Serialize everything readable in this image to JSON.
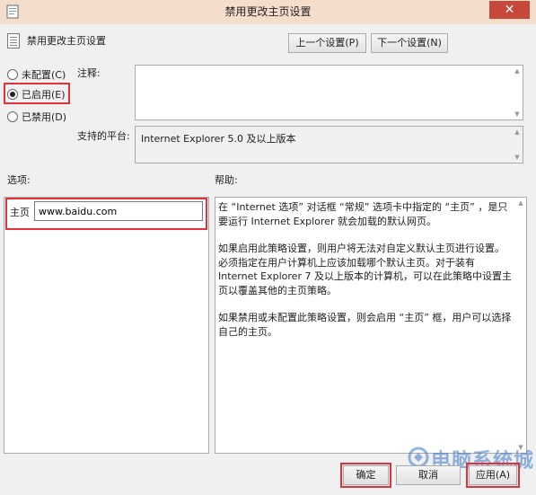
{
  "window": {
    "title": "禁用更改主页设置",
    "close_glyph": "✕"
  },
  "header": {
    "policy_name": "禁用更改主页设置",
    "prev_label": "上一个设置(P)",
    "next_label": "下一个设置(N)"
  },
  "state": {
    "options": [
      {
        "label": "未配置(C)",
        "selected": false
      },
      {
        "label": "已启用(E)",
        "selected": true
      },
      {
        "label": "已禁用(D)",
        "selected": false
      }
    ]
  },
  "comment": {
    "label": "注释:",
    "value": ""
  },
  "platform": {
    "label": "支持的平台:",
    "value": "Internet Explorer 5.0 及以上版本"
  },
  "options_section": {
    "label": "选项:",
    "homepage_label": "主页",
    "homepage_value": "www.baidu.com"
  },
  "help_section": {
    "label": "帮助:",
    "paragraphs": [
      "在 “Internet 选项” 对话框 “常规” 选项卡中指定的 “主页” ，是只要运行 Internet Explorer 就会加载的默认网页。",
      "如果启用此策略设置，则用户将无法对自定义默认主页进行设置。必须指定在用户计算机上应该加载哪个默认主页。对于装有 Internet Explorer 7 及以上版本的计算机，可以在此策略中设置主页以覆盖其他的主页策略。",
      "如果禁用或未配置此策略设置，则会启用 “主页” 框，用户可以选择自己的主页。"
    ]
  },
  "footer": {
    "ok_label": "确定",
    "cancel_label": "取消",
    "apply_label": "应用(A)"
  },
  "watermark": {
    "text": "电脑系统城"
  },
  "colors": {
    "highlight": "#e2323a",
    "titlebar": "#f4ddcb",
    "close": "#c7473a"
  }
}
